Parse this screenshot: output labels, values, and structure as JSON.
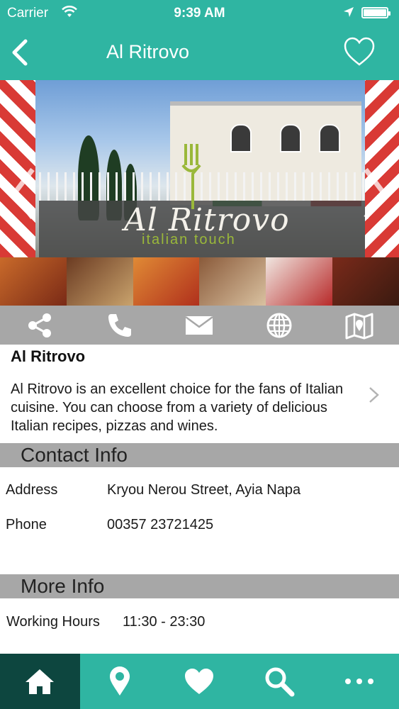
{
  "status_bar": {
    "carrier": "Carrier",
    "time": "9:39 AM"
  },
  "nav": {
    "title": "Al Ritrovo",
    "back_icon": "chevron-left-icon",
    "favorite_icon": "heart-outline-icon"
  },
  "hero": {
    "logo_text": "Al Ritrovo",
    "logo_subtitle": "italian touch"
  },
  "actions": [
    {
      "icon": "share-icon"
    },
    {
      "icon": "phone-icon"
    },
    {
      "icon": "mail-icon"
    },
    {
      "icon": "globe-icon"
    },
    {
      "icon": "map-icon"
    }
  ],
  "business": {
    "name": "Al Ritrovo",
    "description": "Al Ritrovo is an excellent choice for the fans of Italian cuisine. You can choose from a variety of delicious Italian recipes, pizzas and wines."
  },
  "contact": {
    "heading": "Contact Info",
    "rows": [
      {
        "label": "Address",
        "value": "Kryou Nerou Street, Ayia Napa"
      },
      {
        "label": "Phone",
        "value": "00357 23721425"
      }
    ]
  },
  "more": {
    "heading": "More Info",
    "rows": [
      {
        "label": "Working Hours",
        "value": "11:30 - 23:30"
      }
    ]
  },
  "tabbar": [
    {
      "icon": "home-icon",
      "active": true
    },
    {
      "icon": "location-pin-icon",
      "active": false
    },
    {
      "icon": "heart-icon",
      "active": false
    },
    {
      "icon": "search-icon",
      "active": false
    },
    {
      "icon": "more-icon",
      "active": false
    }
  ],
  "colors": {
    "accent": "#2fb5a2",
    "accent_dark": "#0d463f",
    "section_gray": "#a7a7a7"
  }
}
